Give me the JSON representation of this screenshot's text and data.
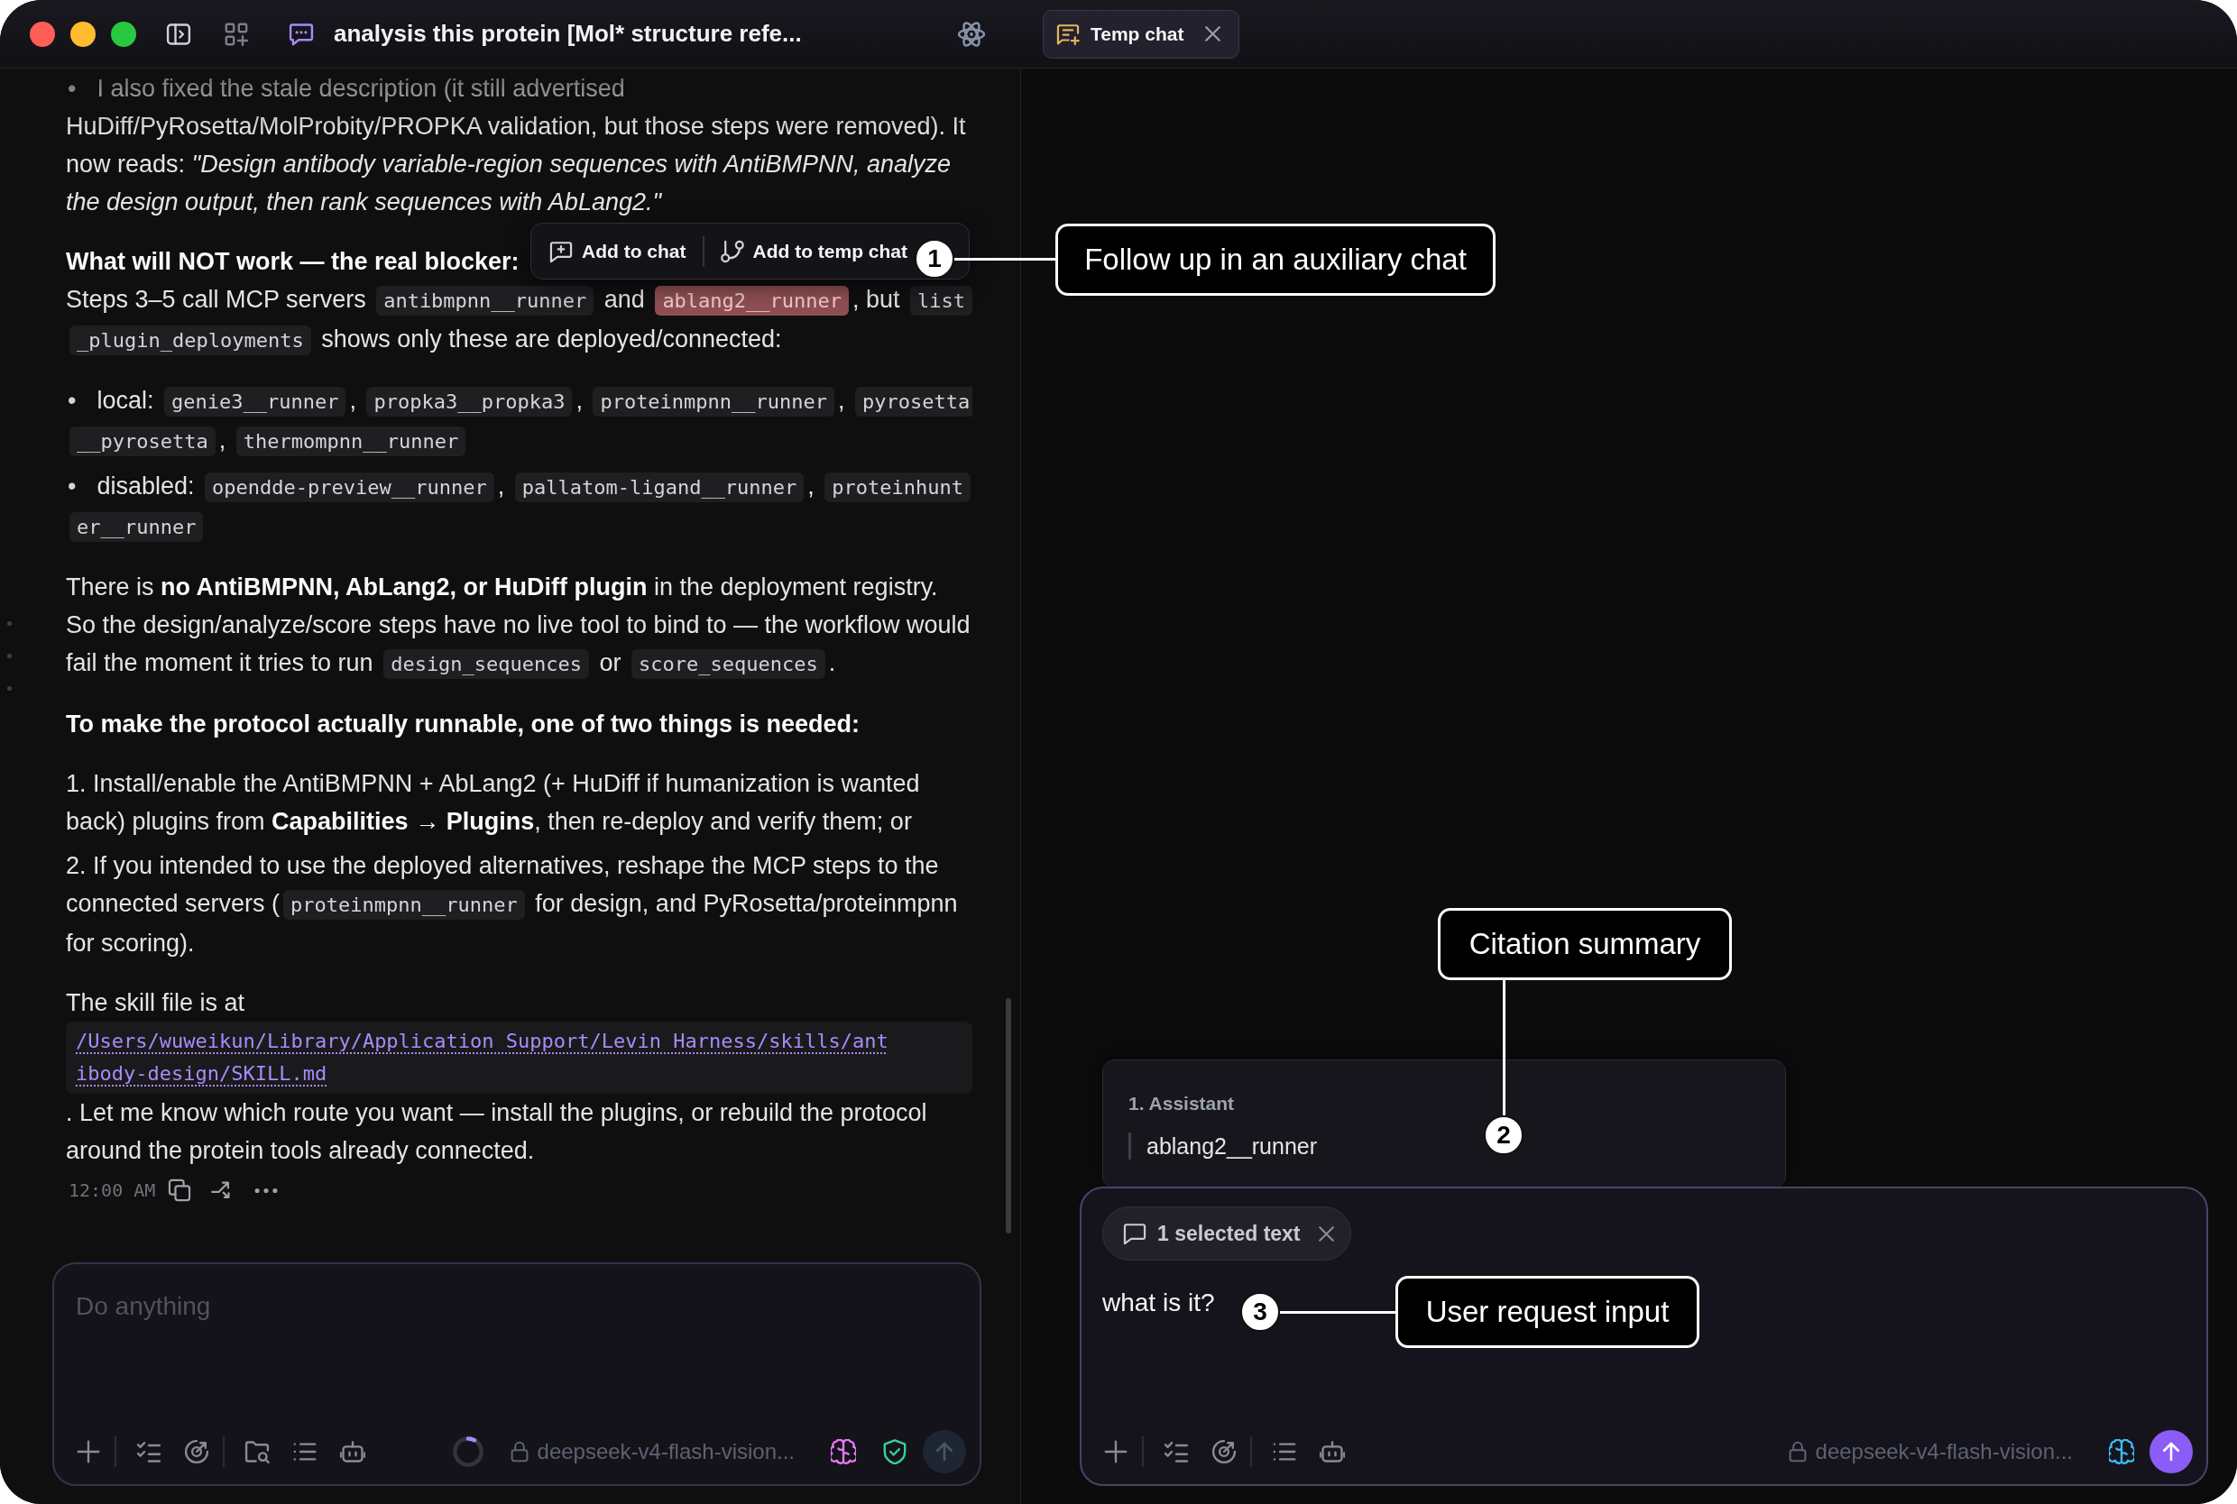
{
  "title_bar": {
    "title": "analysis this protein [Mol* structure refe...",
    "tabs": [
      {
        "label": "Temp chat",
        "selected": true
      }
    ]
  },
  "main_chat": {
    "blocks": [
      {
        "kind": "bullet",
        "marker": "•",
        "segments": [
          {
            "kind": "text",
            "text": "I also fixed the stale description (it still advertised HuDiff/PyRosetta/MolProbity/PROPKA validation, but those steps were removed). It now reads: *\"Design antibody variable-region sequences with AntiBMPNN, analyze the design output, then rank sequences with AbLang2.\"*"
          }
        ]
      },
      {
        "kind": "paragraph",
        "lead": "What will NOT work — the real blocker:",
        "segments": [
          {
            "kind": "text",
            "text": "Steps 3–5 call MCP servers "
          },
          {
            "kind": "code",
            "text": "antibmpnn__runner",
            "highlighted": false
          },
          {
            "kind": "text",
            "text": " and "
          },
          {
            "kind": "code",
            "text": "ablang2__runner",
            "highlighted": true
          },
          {
            "kind": "text",
            "text": ", but "
          },
          {
            "kind": "code",
            "text": "list_plugin_deployments",
            "highlighted": false
          },
          {
            "kind": "text",
            "text": " shows only these are deployed/connected:"
          }
        ]
      },
      {
        "kind": "bullet",
        "marker": "•",
        "segments": [
          {
            "kind": "text",
            "text": "local: "
          },
          {
            "kind": "code",
            "text": "genie3__runner",
            "highlighted": false
          },
          {
            "kind": "text",
            "text": ", "
          },
          {
            "kind": "code",
            "text": "propka3__propka3",
            "highlighted": false
          },
          {
            "kind": "text",
            "text": ", "
          },
          {
            "kind": "code",
            "text": "proteinmpnn__runner",
            "highlighted": false
          },
          {
            "kind": "text",
            "text": ", "
          },
          {
            "kind": "code",
            "text": "pyrosetta__pyrosetta",
            "highlighted": false
          },
          {
            "kind": "text",
            "text": ", "
          },
          {
            "kind": "code",
            "text": "thermompnn__runner",
            "highlighted": false
          }
        ]
      },
      {
        "kind": "bullet",
        "marker": "•",
        "segments": [
          {
            "kind": "text",
            "text": "disabled: "
          },
          {
            "kind": "code",
            "text": "opendde-preview__runner",
            "highlighted": false
          },
          {
            "kind": "text",
            "text": ", "
          },
          {
            "kind": "code",
            "text": "pallatom-ligand__runner",
            "highlighted": false
          },
          {
            "kind": "text",
            "text": ", "
          },
          {
            "kind": "code",
            "text": "proteinhunter__runner",
            "highlighted": false
          }
        ]
      },
      {
        "kind": "paragraph",
        "segments": [
          {
            "kind": "text",
            "text": "There is **no AntiBMPNN, AbLang2, or HuDiff plugin** in the deployment registry. So the design/analyze/score steps have no live tool to bind to — the workflow would fail the moment it tries to run "
          },
          {
            "kind": "code",
            "text": "design_sequences",
            "highlighted": false
          },
          {
            "kind": "text",
            "text": " or "
          },
          {
            "kind": "code",
            "text": "score_sequences",
            "highlighted": false
          },
          {
            "kind": "text",
            "text": "."
          }
        ]
      },
      {
        "kind": "heading",
        "text": "To make the protocol actually runnable, one of two things is needed:"
      },
      {
        "kind": "numbered",
        "segments": [
          {
            "kind": "text",
            "text": "1. Install/enable the AntiBMPNN + AbLang2 (+ HuDiff if humanization is wanted back) plugins from **Capabilities → Plugins**, then re-deploy and verify them; or"
          }
        ]
      },
      {
        "kind": "numbered",
        "segments": [
          {
            "kind": "text",
            "text": "2. If you intended to use the deployed alternatives, reshape the MCP steps to the connected servers ("
          },
          {
            "kind": "code",
            "text": "proteinmpnn__runner",
            "highlighted": false
          },
          {
            "kind": "text",
            "text": " for design, and PyRosetta/proteinmpnn for scoring)."
          }
        ]
      },
      {
        "kind": "paragraph",
        "segments": [
          {
            "kind": "text",
            "text": "The skill file is at"
          }
        ]
      },
      {
        "kind": "file_link",
        "text": "/Users/wuweikun/Library/Application Support/Levin Harness/skills/antibody-design/SKILL.md"
      },
      {
        "kind": "paragraph",
        "segments": [
          {
            "kind": "text",
            "text": ". Let me know which route you want — install the plugins, or rebuild the protocol around the protein tools already connected."
          }
        ]
      }
    ],
    "timestamp": "12:00 AM",
    "composer": {
      "placeholder": "Do anything",
      "context": {
        "level": 0.08
      },
      "model": "deepseek-v4-flash-vision...",
      "send_enabled": false
    }
  },
  "selection_popup": {
    "actions": [
      {
        "kind": "chat",
        "label": "Add to chat"
      },
      {
        "kind": "temp_chat",
        "label": "Add to temp chat"
      }
    ]
  },
  "temp_chat": {
    "citation": {
      "source": "1. Assistant",
      "quote": "ablang2__runner"
    },
    "composer": {
      "attachment": "1 selected text",
      "value": "what is it?",
      "model": "deepseek-v4-flash-vision...",
      "send_enabled": true
    }
  },
  "callouts": [
    {
      "number": "1",
      "label": "Follow up in an auxiliary chat"
    },
    {
      "number": "2",
      "label": "Citation summary"
    },
    {
      "number": "3",
      "label": "User request input"
    }
  ]
}
